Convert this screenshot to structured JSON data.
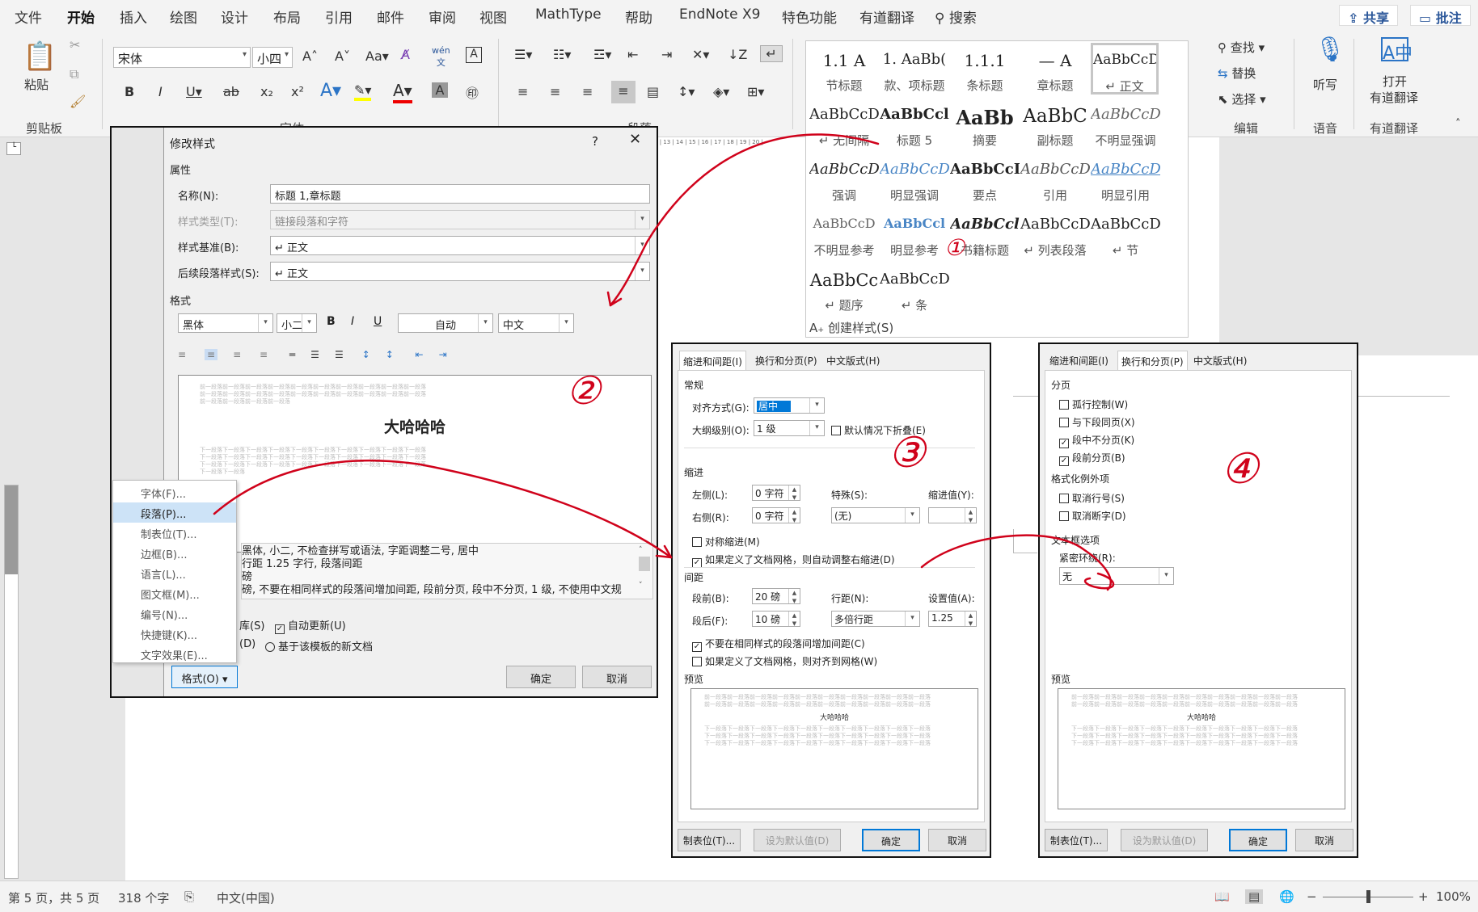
{
  "menubar": {
    "items": [
      "文件",
      "开始",
      "插入",
      "绘图",
      "设计",
      "布局",
      "引用",
      "邮件",
      "审阅",
      "视图",
      "MathType",
      "帮助",
      "EndNote X9",
      "特色功能",
      "有道翻译"
    ],
    "search": "搜索",
    "share": "共享",
    "comment": "批注"
  },
  "ribbon": {
    "clipboard": {
      "paste": "粘贴",
      "group": "剪贴板"
    },
    "font": {
      "name": "宋体",
      "size": "小四",
      "group": "字体"
    },
    "paragraph": {
      "group": "段落"
    },
    "styles_gallery": [
      {
        "preview": "1.1  A",
        "name": "节标题"
      },
      {
        "preview": "1.  AaBb(",
        "name": "款、项标题"
      },
      {
        "preview": "1.1.1",
        "name": "条标题"
      },
      {
        "preview": "— A",
        "name": "章标题"
      },
      {
        "preview": "AaBbCcD",
        "name": "↵ 正文"
      },
      {
        "preview": "AaBbCcD",
        "name": "↵ 无间隔"
      },
      {
        "preview": "AaBbCcl",
        "name": "标题 5"
      },
      {
        "preview": "AaBb",
        "name": "摘要"
      },
      {
        "preview": "AaBbC",
        "name": "副标题"
      },
      {
        "preview": "AaBbCcD",
        "name": "不明显强调"
      },
      {
        "preview": "AaBbCcD",
        "name": "强调"
      },
      {
        "preview": "AaBbCcD",
        "name": "明显强调"
      },
      {
        "preview": "AaBbCcD",
        "name": "要点"
      },
      {
        "preview": "AaBbCcD",
        "name": "引用"
      },
      {
        "preview": "AaBbCcD",
        "name": "明显引用"
      },
      {
        "preview": "AaBbCcD",
        "name": "不明显参考"
      },
      {
        "preview": "AaBbCcl",
        "name": "明显参考"
      },
      {
        "preview": "AaBbCcl",
        "name": "书籍标题"
      },
      {
        "preview": "AaBbCcD",
        "name": "↵ 列表段落"
      },
      {
        "preview": "AaBbCcD",
        "name": "↵ 节"
      },
      {
        "preview": "AaBbCc",
        "name": "↵ 题序"
      },
      {
        "preview": "AaBbCcD",
        "name": "↵ 条"
      }
    ],
    "create_style": "创建样式(S)",
    "editing": {
      "find": "查找",
      "replace": "替换",
      "select": "选择",
      "group": "编辑"
    },
    "voice": {
      "dictate": "听写",
      "group": "语音"
    },
    "youdao": {
      "open": "打开",
      "translate": "有道翻译",
      "group": "有道翻译"
    }
  },
  "modify_dialog": {
    "title": "修改样式",
    "help": "?",
    "properties": "属性",
    "name_label": "名称(N):",
    "name_value": "标题 1,章标题",
    "type_label": "样式类型(T):",
    "type_value": "链接段落和字符",
    "based_label": "样式基准(B):",
    "based_value": "↵ 正文",
    "next_label": "后续段落样式(S):",
    "next_value": "↵ 正文",
    "format": "格式",
    "font": "黑体",
    "size": "小二",
    "bold": "B",
    "italic": "I",
    "underline": "U",
    "color": "自动",
    "lang": "中文",
    "preview_before": [
      "前一段落前一段落前一段落前一段落前一段落前一段落前一段落前一段落前一段落前一段落",
      "前一段落前一段落前一段落前一段落前一段落前一段落前一段落前一段落前一段落前一段落",
      "前一段落前一段落前一段落前一段落"
    ],
    "preview_text": "大哈哈哈",
    "preview_after": [
      "下一段落下一段落下一段落下一段落下一段落下一段落下一段落下一段落下一段落下一段落",
      "下一段落下一段落下一段落下一段落下一段落下一段落下一段落下一段落下一段落下一段落",
      "下一段落下一段落下一段落下一段落下一段落下一段落下一段落下一段落下一段落下一段落",
      "下一段落下一段落"
    ],
    "desc": [
      "黑体, 小二, 不检查拼写或语法, 字距调整二号, 居中",
      "行距 1.25 字行, 段落间距",
      "磅",
      "磅, 不要在相同样式的段落间增加间距, 段前分页, 段中不分页, 1 级, 不使用中文规"
    ],
    "add_lib": "库(S)",
    "auto_update": "自动更新(U)",
    "only_doc": "(D)",
    "new_template": "基于该模板的新文档",
    "format_btn": "格式(O)",
    "ok": "确定",
    "cancel": "取消",
    "menu": [
      "字体(F)...",
      "段落(P)...",
      "制表位(T)...",
      "边框(B)...",
      "语言(L)...",
      "图文框(M)...",
      "编号(N)...",
      "快捷键(K)...",
      "文字效果(E)..."
    ]
  },
  "para_dialog3": {
    "tabs": [
      "缩进和间距(I)",
      "换行和分页(P)",
      "中文版式(H)"
    ],
    "general": "常规",
    "align_label": "对齐方式(G):",
    "align_value": "居中",
    "outline_label": "大纲级别(O):",
    "outline_value": "1 级",
    "collapse": "默认情况下折叠(E)",
    "indent": "缩进",
    "left_label": "左侧(L):",
    "left_value": "0 字符",
    "right_label": "右侧(R):",
    "right_value": "0 字符",
    "special_label": "特殊(S):",
    "special_value": "(无)",
    "indent_val_label": "缩进值(Y):",
    "mirror": "对称缩进(M)",
    "auto_right": "如果定义了文档网格，则自动调整右缩进(D)",
    "spacing": "间距",
    "before_label": "段前(B):",
    "before_value": "20 磅",
    "after_label": "段后(F):",
    "after_value": "10 磅",
    "line_label": "行距(N):",
    "line_value": "多倍行距",
    "set_label": "设置值(A):",
    "set_value": "1.25",
    "no_space": "不要在相同样式的段落间增加间距(C)",
    "snap_grid": "如果定义了文档网格，则对齐到网格(W)",
    "preview": "预览",
    "tabs_btn": "制表位(T)...",
    "default_btn": "设为默认值(D)",
    "ok": "确定",
    "cancel": "取消"
  },
  "para_dialog4": {
    "tabs": [
      "缩进和间距(I)",
      "换行和分页(P)",
      "中文版式(H)"
    ],
    "pagination": "分页",
    "widow": "孤行控制(W)",
    "keep_next": "与下段同页(X)",
    "keep_lines": "段中不分页(K)",
    "page_before": "段前分页(B)",
    "exceptions": "格式化例外项",
    "suppress": "取消行号(S)",
    "no_hyphen": "取消断字(D)",
    "textbox": "文本框选项",
    "wrap_label": "紧密环绕(R):",
    "wrap_value": "无",
    "preview": "预览",
    "tabs_btn": "制表位(T)...",
    "default_btn": "设为默认值(D)",
    "ok": "确定",
    "cancel": "取消"
  },
  "preview_small": "大哈哈哈",
  "annotations": [
    "①",
    "②",
    "③",
    "④"
  ],
  "status": {
    "page": "第 5 页，共 5 页",
    "words": "318 个字",
    "lang": "中文(中国)",
    "zoom": "100%"
  },
  "colors": {
    "accent": "#2b579a",
    "annotation": "#d0021b"
  }
}
